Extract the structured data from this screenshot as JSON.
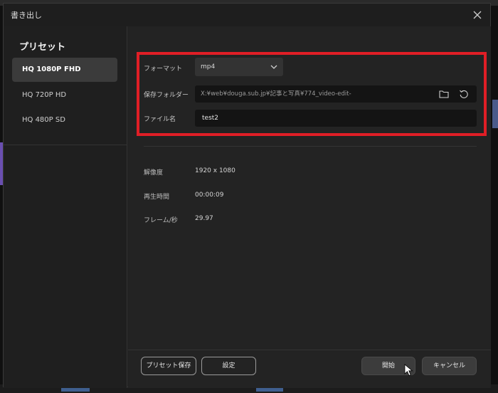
{
  "dialog": {
    "title": "書き出し"
  },
  "sidebar": {
    "heading": "プリセット",
    "presets": [
      {
        "label": "HQ 1080P FHD",
        "active": true
      },
      {
        "label": "HQ 720P HD",
        "active": false
      },
      {
        "label": "HQ 480P SD",
        "active": false
      }
    ]
  },
  "settings": {
    "format_label": "フォーマット",
    "format_value": "mp4",
    "folder_label": "保存フォルダー",
    "folder_value": "X:¥web¥douga.sub.jp¥記事と写真¥774_video-edit-",
    "filename_label": "ファイル名",
    "filename_value": "test2"
  },
  "info": {
    "resolution_label": "解像度",
    "resolution_value": "1920  x  1080",
    "duration_label": "再生時間",
    "duration_value": "00:00:09",
    "framerate_label": "フレーム/秒",
    "framerate_value": "29.97"
  },
  "footer": {
    "save_preset": "プリセット保存",
    "settings": "設定",
    "start": "開始",
    "cancel": "キャンセル"
  },
  "icons": {
    "close": "close-icon",
    "dropdown": "chevron-down-icon",
    "folder": "folder-icon",
    "reset": "reset-icon",
    "cursor": "cursor-icon"
  },
  "colors": {
    "highlight": "#e01e26",
    "accent_bg": "#3b3b3b"
  }
}
